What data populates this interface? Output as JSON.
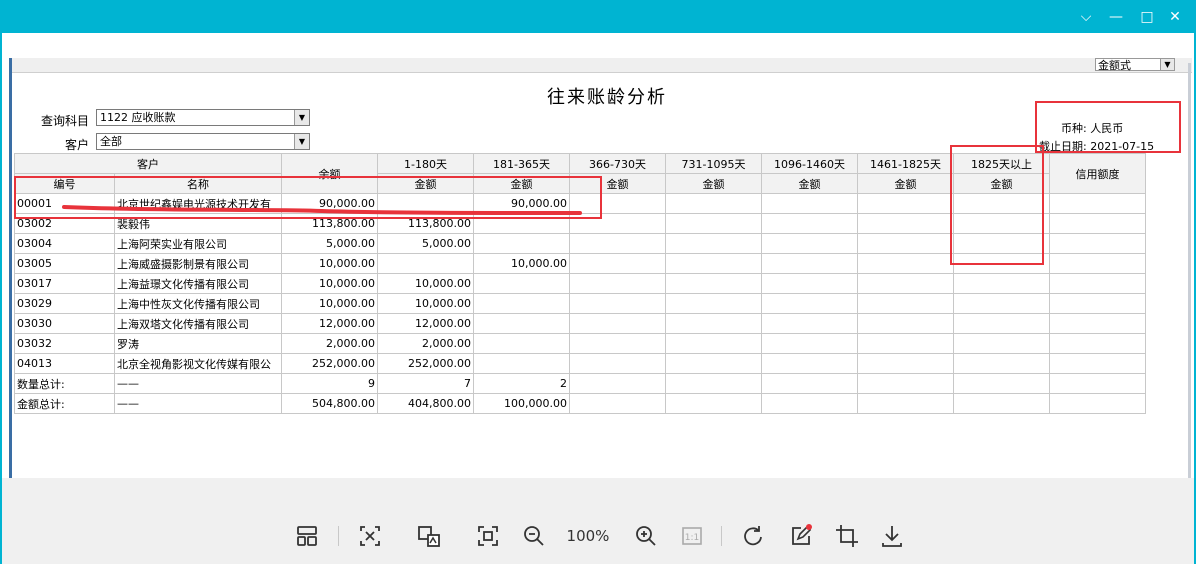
{
  "window": {
    "controls": [
      "chevron-down",
      "minimize",
      "maximize",
      "close"
    ]
  },
  "toolbar_top": {
    "format_select": "金额式"
  },
  "report": {
    "title": "往来账龄分析",
    "query_subject_label": "查询科目",
    "query_subject_value": "1122 应收账款",
    "customer_label": "客户",
    "customer_value": "全部",
    "currency": "币种: 人民币",
    "cutoff_date": "截止日期: 2021-07-15"
  },
  "table": {
    "header_group_customer": "客户",
    "header_code": "编号",
    "header_name": "名称",
    "header_balance": "余额",
    "buckets": [
      "1-180天",
      "181-365天",
      "366-730天",
      "731-1095天",
      "1096-1460天",
      "1461-1825天",
      "1825天以上"
    ],
    "amount_label": "金额",
    "credit_limit": "信用额度",
    "rows": [
      {
        "code": "00001",
        "name": "北京世纪鑫娱电光源技术开发有",
        "balance": "90,000.00",
        "b1": "",
        "b2": "90,000.00"
      },
      {
        "code": "03002",
        "name": "裴毅伟",
        "balance": "113,800.00",
        "b1": "113,800.00",
        "b2": ""
      },
      {
        "code": "03004",
        "name": "上海阿荣实业有限公司",
        "balance": "5,000.00",
        "b1": "5,000.00",
        "b2": ""
      },
      {
        "code": "03005",
        "name": "上海威盛摄影制景有限公司",
        "balance": "10,000.00",
        "b1": "",
        "b2": "10,000.00"
      },
      {
        "code": "03017",
        "name": "上海益璟文化传播有限公司",
        "balance": "10,000.00",
        "b1": "10,000.00",
        "b2": ""
      },
      {
        "code": "03029",
        "name": "上海中性灰文化传播有限公司",
        "balance": "10,000.00",
        "b1": "10,000.00",
        "b2": ""
      },
      {
        "code": "03030",
        "name": "上海双塔文化传播有限公司",
        "balance": "12,000.00",
        "b1": "12,000.00",
        "b2": ""
      },
      {
        "code": "03032",
        "name": "罗涛",
        "balance": "2,000.00",
        "b1": "2,000.00",
        "b2": ""
      },
      {
        "code": "04013",
        "name": "北京全视角影视文化传媒有限公",
        "balance": "252,000.00",
        "b1": "252,000.00",
        "b2": ""
      },
      {
        "code": "数量总计:",
        "name": "——",
        "balance": "9",
        "b1": "7",
        "b2": "2"
      },
      {
        "code": "金额总计:",
        "name": "——",
        "balance": "504,800.00",
        "b1": "404,800.00",
        "b2": "100,000.00"
      }
    ]
  },
  "viewer": {
    "zoom": "100%"
  }
}
